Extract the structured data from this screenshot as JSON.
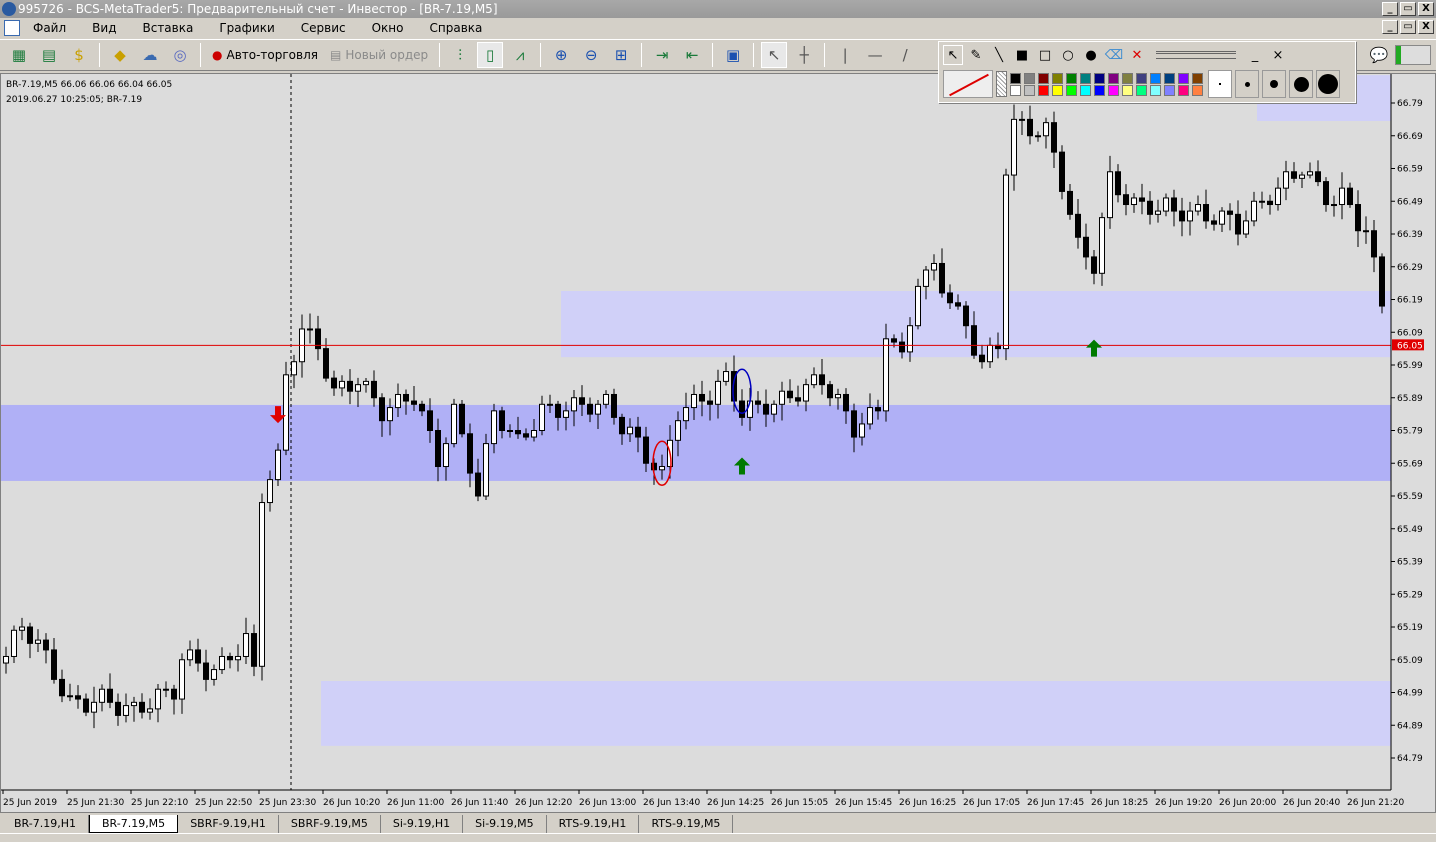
{
  "window": {
    "title": "995726 - BCS-MetaTrader5: Предварительный счет - Инвестор - [BR-7.19,M5]",
    "min": "_",
    "restore": "▭",
    "close": "X"
  },
  "menu": [
    "Файл",
    "Вид",
    "Вставка",
    "Графики",
    "Сервис",
    "Окно",
    "Справка"
  ],
  "toolbar": {
    "autotrading": "Авто-торговля",
    "new_order": "Новый ордер"
  },
  "chart_info": {
    "line1": "BR-7.19,M5  66.06 66.06 66.04 66.05",
    "line2": "2019.06.27 10:25:05; BR-7.19"
  },
  "chart_data": {
    "type": "candlestick",
    "symbol": "BR-7.19,M5",
    "ylim": [
      64.74,
      66.84
    ],
    "price_ticks": [
      "66.79",
      "66.69",
      "66.59",
      "66.49",
      "66.39",
      "66.29",
      "66.19",
      "66.09",
      "65.99",
      "65.89",
      "65.79",
      "65.69",
      "65.59",
      "65.49",
      "65.39",
      "65.29",
      "65.19",
      "65.09",
      "64.99",
      "64.89",
      "64.79"
    ],
    "time_ticks": [
      "25 Jun 2019",
      "25 Jun 21:30",
      "25 Jun 22:10",
      "25 Jun 22:50",
      "25 Jun 23:30",
      "26 Jun 10:20",
      "26 Jun 11:00",
      "26 Jun 11:40",
      "26 Jun 12:20",
      "26 Jun 13:00",
      "26 Jun 13:40",
      "26 Jun 14:25",
      "26 Jun 15:05",
      "26 Jun 15:45",
      "26 Jun 16:25",
      "26 Jun 17:05",
      "26 Jun 17:45",
      "26 Jun 18:25",
      "26 Jun 19:20",
      "26 Jun 20:00",
      "26 Jun 20:40",
      "26 Jun 21:20"
    ],
    "candle_count": 173,
    "close_keypoints": [
      [
        0,
        65.1
      ],
      [
        2,
        65.2
      ],
      [
        5,
        65.1
      ],
      [
        8,
        64.95
      ],
      [
        12,
        64.97
      ],
      [
        16,
        64.93
      ],
      [
        21,
        65.0
      ],
      [
        22,
        65.1
      ],
      [
        26,
        65.05
      ],
      [
        30,
        65.15
      ],
      [
        31,
        65.05
      ],
      [
        32,
        65.6
      ],
      [
        34,
        65.7
      ],
      [
        35,
        65.95
      ],
      [
        37,
        66.1
      ],
      [
        39,
        66.05
      ],
      [
        41,
        65.9
      ],
      [
        44,
        65.95
      ],
      [
        47,
        65.85
      ],
      [
        51,
        65.9
      ],
      [
        54,
        65.7
      ],
      [
        56,
        65.85
      ],
      [
        59,
        65.6
      ],
      [
        61,
        65.85
      ],
      [
        64,
        65.75
      ],
      [
        67,
        65.85
      ],
      [
        75,
        65.87
      ],
      [
        79,
        65.75
      ],
      [
        82,
        65.65
      ],
      [
        84,
        65.85
      ],
      [
        88,
        65.9
      ],
      [
        90,
        65.95
      ],
      [
        92,
        65.85
      ],
      [
        97,
        65.88
      ],
      [
        102,
        65.95
      ],
      [
        106,
        65.8
      ],
      [
        109,
        65.85
      ],
      [
        110,
        66.1
      ],
      [
        112,
        66.0
      ],
      [
        114,
        66.25
      ],
      [
        116,
        66.28
      ],
      [
        120,
        66.1
      ],
      [
        122,
        66.0
      ],
      [
        124,
        66.05
      ],
      [
        125,
        66.6
      ],
      [
        126,
        66.72
      ],
      [
        130,
        66.7
      ],
      [
        132,
        66.55
      ],
      [
        134,
        66.35
      ],
      [
        136,
        66.3
      ],
      [
        138,
        66.55
      ],
      [
        141,
        66.48
      ],
      [
        150,
        66.45
      ],
      [
        154,
        66.42
      ],
      [
        160,
        66.55
      ],
      [
        162,
        66.6
      ],
      [
        165,
        66.5
      ],
      [
        167,
        66.5
      ],
      [
        170,
        66.4
      ],
      [
        172,
        66.18
      ]
    ],
    "last_price": "66.05",
    "zones": [
      {
        "from": 65.636,
        "to": 65.868,
        "start_candle": 0,
        "color": "#b0b0f6"
      },
      {
        "from": 66.014,
        "to": 66.216,
        "start_candle": 70,
        "color": "#d0d0f8"
      },
      {
        "from": 64.827,
        "to": 65.025,
        "start_candle": 40,
        "color": "#d0d0f8"
      },
      {
        "from": 66.735,
        "to": 66.875,
        "start_candle": 157,
        "color": "#d0d0f8"
      }
    ],
    "arrows": [
      {
        "dir": "down",
        "candle": 34,
        "price": 65.84,
        "color": "#e00000"
      },
      {
        "dir": "up",
        "candle": 92,
        "price": 65.68,
        "color": "#007a00"
      },
      {
        "dir": "up",
        "candle": 136,
        "price": 66.04,
        "color": "#007a00"
      }
    ],
    "ellipses": [
      {
        "candle": 82,
        "price": 65.69,
        "color": "#e00000"
      },
      {
        "candle": 92,
        "price": 65.91,
        "color": "#0000c0"
      }
    ],
    "separator_candle": 36
  },
  "tabs": [
    "BR-7.19,H1",
    "BR-7.19,M5",
    "SBRF-9.19,H1",
    "SBRF-9.19,M5",
    "Si-9.19,H1",
    "Si-9.19,M5",
    "RTS-9.19,H1",
    "RTS-9.19,M5"
  ],
  "active_tab": "BR-7.19,M5",
  "colors": [
    "#000000",
    "#808080",
    "#800000",
    "#808000",
    "#008000",
    "#008080",
    "#000080",
    "#800080",
    "#808040",
    "#404080",
    "#0080ff",
    "#004080",
    "#8000ff",
    "#804000",
    "#ffffff",
    "#c0c0c0",
    "#ff0000",
    "#ffff00",
    "#00ff00",
    "#00ffff",
    "#0000ff",
    "#ff00ff",
    "#ffff80",
    "#00ff80",
    "#80ffff",
    "#8080ff",
    "#ff0080",
    "#ff8040"
  ]
}
